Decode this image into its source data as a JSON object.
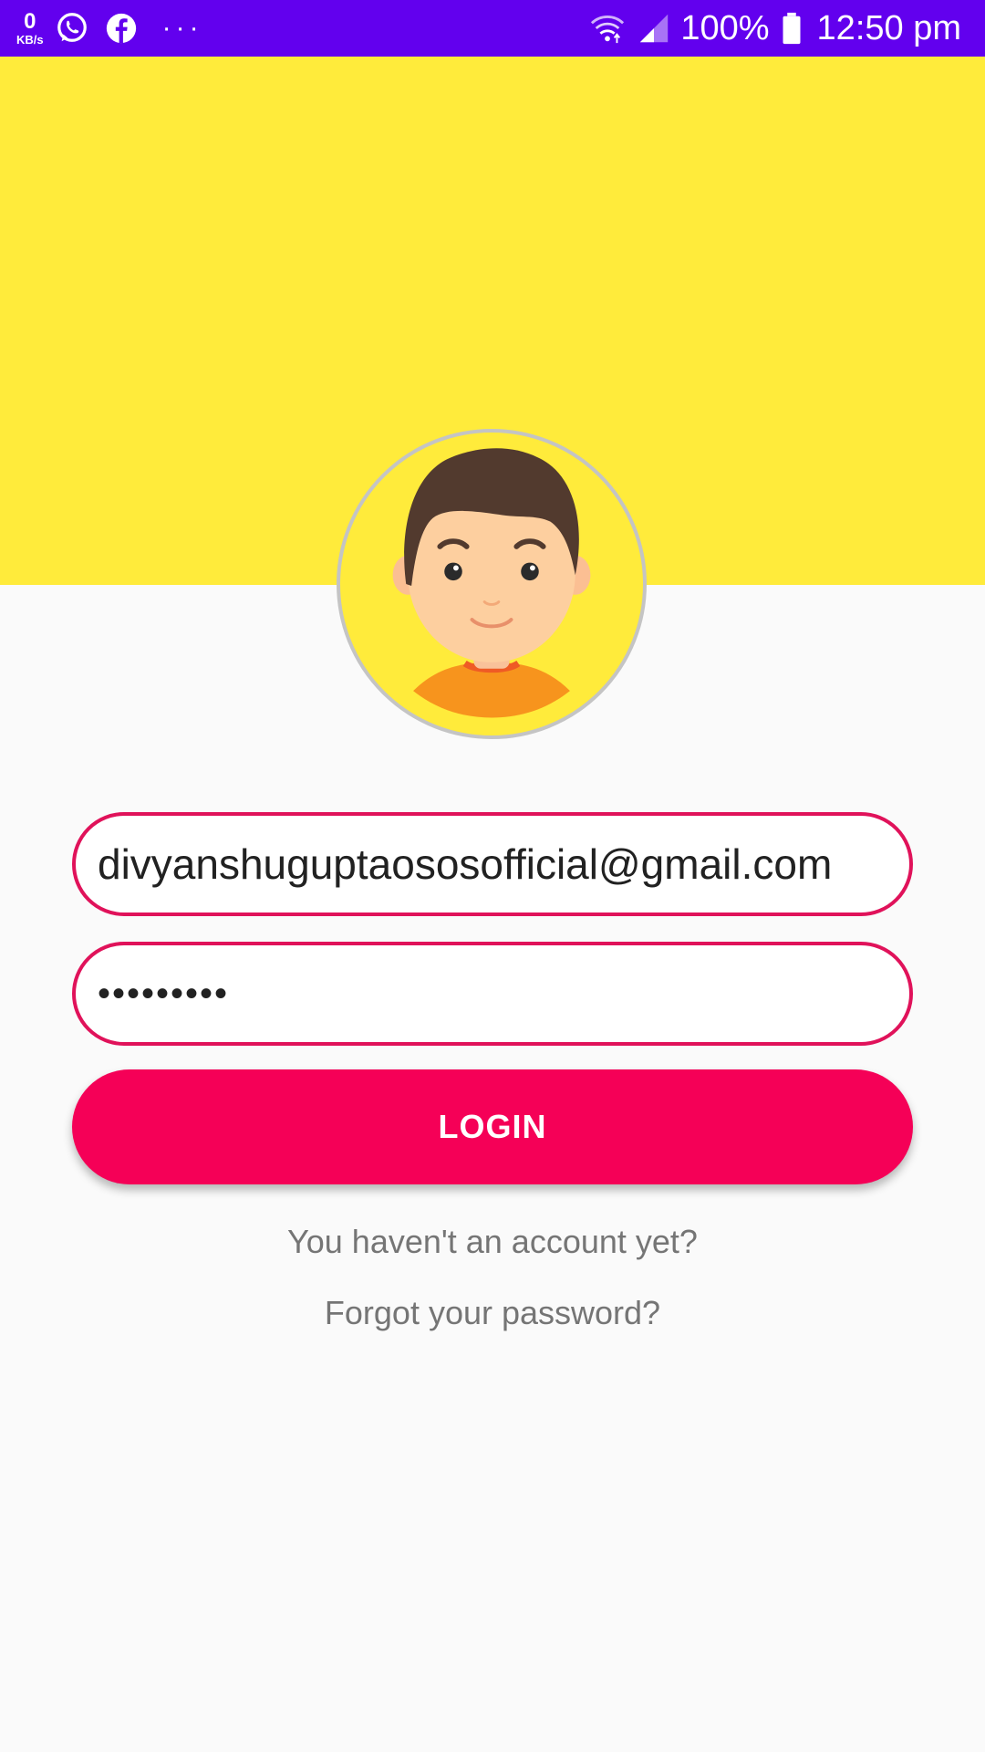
{
  "colors": {
    "status_bar": "#6200ee",
    "header": "#ffeb3b",
    "accent": "#f50057",
    "field_border": "#e0125a",
    "link_text": "#757575",
    "background": "#fafafa"
  },
  "status_bar": {
    "data_rate_value": "0",
    "data_rate_unit": "KB/s",
    "notification_icons": [
      "whatsapp-icon",
      "facebook-icon",
      "more-dots-icon"
    ],
    "more_indicator": "···",
    "system_icons": [
      "wifi-icon",
      "signal-icon",
      "battery-icon"
    ],
    "battery_percent": "100%",
    "time": "12:50 pm"
  },
  "avatar": {
    "icon": "profile-avatar-boy"
  },
  "login_form": {
    "email_value": "divyanshuguptaososofficial@gmail.com",
    "password_value": "•••••••••",
    "login_label": "LOGIN",
    "signup_link": "You haven't an account yet?",
    "forgot_link": "Forgot your password?"
  }
}
